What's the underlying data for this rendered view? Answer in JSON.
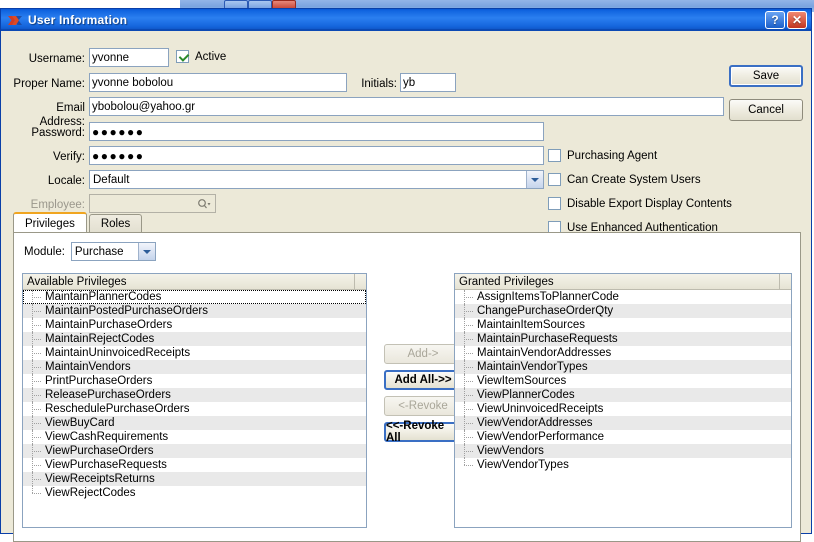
{
  "window": {
    "title": "User Information",
    "logo_icon": "xtuple-x-logo-icon",
    "help_button": "?",
    "close_button": "✕"
  },
  "form": {
    "username": {
      "label": "Username:",
      "value": "yvonne"
    },
    "active": {
      "label": "Active",
      "checked": true
    },
    "proper_name": {
      "label": "Proper Name:",
      "value": "yvonne bobolou"
    },
    "initials": {
      "label": "Initials:",
      "value": "yb"
    },
    "email": {
      "label": "Email Address:",
      "value": "ybobolou@yahoo.gr"
    },
    "password": {
      "label": "Password:",
      "value": "●●●●●●"
    },
    "verify": {
      "label": "Verify:",
      "value": "●●●●●●"
    },
    "locale": {
      "label": "Locale:",
      "value": "Default"
    },
    "employee": {
      "label": "Employee:",
      "value": "",
      "lookup_icon": "magnifier-lookup-icon"
    },
    "options": [
      {
        "label": "Purchasing Agent",
        "checked": false
      },
      {
        "label": "Can Create System Users",
        "checked": false
      },
      {
        "label": "Disable Export Display Contents",
        "checked": false
      },
      {
        "label": "Use Enhanced Authentication",
        "checked": false
      }
    ]
  },
  "actions": {
    "save": "Save",
    "cancel": "Cancel"
  },
  "tabs": [
    {
      "label": "Privileges",
      "active": true
    },
    {
      "label": "Roles",
      "active": false
    }
  ],
  "module": {
    "label": "Module:",
    "value": "Purchase"
  },
  "available": {
    "header": "Available Privileges",
    "items": [
      "MaintainPlannerCodes",
      "MaintainPostedPurchaseOrders",
      "MaintainPurchaseOrders",
      "MaintainRejectCodes",
      "MaintainUninvoicedReceipts",
      "MaintainVendors",
      "PrintPurchaseOrders",
      "ReleasePurchaseOrders",
      "ReschedulePurchaseOrders",
      "ViewBuyCard",
      "ViewCashRequirements",
      "ViewPurchaseOrders",
      "ViewPurchaseRequests",
      "ViewReceiptsReturns",
      "ViewRejectCodes"
    ]
  },
  "granted": {
    "header": "Granted Privileges",
    "items": [
      "AssignItemsToPlannerCode",
      "ChangePurchaseOrderQty",
      "MaintainItemSources",
      "MaintainPurchaseRequests",
      "MaintainVendorAddresses",
      "MaintainVendorTypes",
      "ViewItemSources",
      "ViewPlannerCodes",
      "ViewUninvoicedReceipts",
      "ViewVendorAddresses",
      "ViewVendorPerformance",
      "ViewVendors",
      "ViewVendorTypes"
    ]
  },
  "transfer_buttons": [
    {
      "label": "Add->",
      "enabled": false
    },
    {
      "label": "Add All->>",
      "enabled": true
    },
    {
      "label": "<-Revoke",
      "enabled": false
    },
    {
      "label": "<<-Revoke All",
      "enabled": true
    }
  ],
  "colors": {
    "titlebar_blue": "#1165e0",
    "dialog_face": "#ece9d8",
    "tab_accent": "#f0a520",
    "field_border": "#8ba3bf",
    "alt_row": "#e9e9e9"
  }
}
